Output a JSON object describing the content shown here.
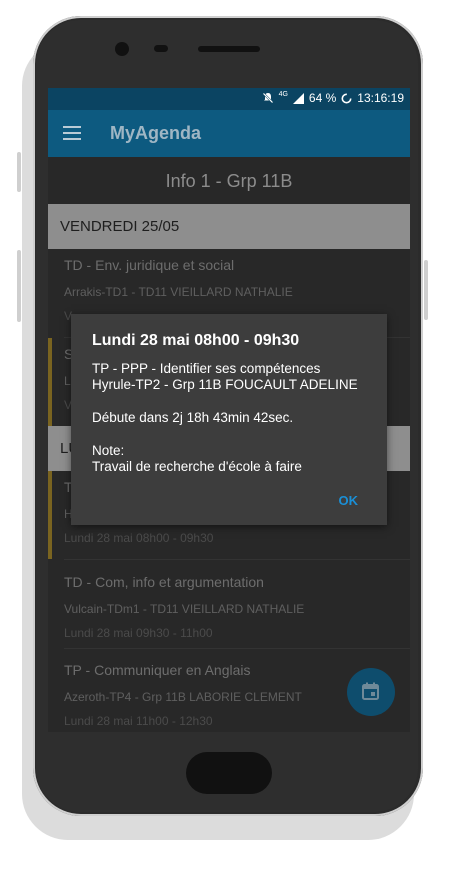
{
  "status_bar": {
    "network": "4G",
    "battery": "64 %",
    "time": "13:16:19"
  },
  "app_bar": {
    "title": "MyAgenda"
  },
  "group_title": "Info 1 - Grp 11B",
  "days": [
    {
      "header": "VENDREDI 25/05",
      "items": [
        {
          "title": "TD - Env. juridique et social",
          "subtitle": "Arrakis-TD1 - TD11 VIEILLARD NATHALIE",
          "date": "V"
        },
        {
          "title": "S",
          "subtitle": "L'",
          "date": "V"
        }
      ]
    },
    {
      "header": "LU",
      "items": [
        {
          "title": "T",
          "subtitle": "H",
          "date": "Lundi 28 mai 08h00 - 09h30"
        },
        {
          "title": "TD - Com, info et argumentation",
          "subtitle": "Vulcain-TDm1 - TD11 VIEILLARD NATHALIE",
          "date": "Lundi 28 mai 09h30 - 11h00"
        },
        {
          "title": "TP - Communiquer en Anglais",
          "subtitle": "Azeroth-TP4 - Grp 11B LABORIE CLEMENT",
          "date": "Lundi 28 mai 11h00 - 12h30"
        }
      ]
    }
  ],
  "dialog": {
    "title": "Lundi 28 mai 08h00 - 09h30",
    "line1": "TP - PPP - Identifier ses compétences",
    "line2": "Hyrule-TP2 - Grp 11B FOUCAULT ADELINE",
    "countdown": "Débute dans 2j 18h 43min 42sec.",
    "note_label": "Note:",
    "note_text": "Travail de recherche d'école à faire",
    "ok_label": "OK"
  },
  "icons": {
    "menu": "hamburger-icon",
    "fab": "calendar-icon",
    "notifications_off": "bell-off-icon",
    "signal": "signal-icon",
    "battery": "battery-charging-icon"
  },
  "colors": {
    "status_bar": "#0b4462",
    "app_bar": "#0d5a80",
    "accent": "#1a8fd6",
    "marker": "#7a6420"
  }
}
